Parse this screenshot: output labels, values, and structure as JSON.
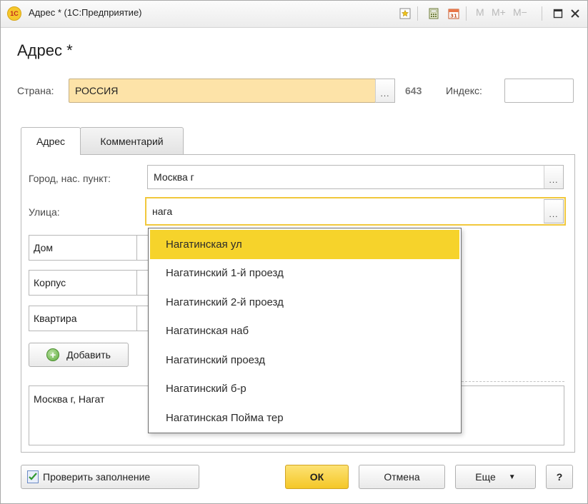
{
  "window": {
    "title": "Адрес * (1С:Предприятие)",
    "logo": "1С",
    "mem_buttons": [
      "M",
      "M+",
      "M−"
    ],
    "icons": [
      "favorite-icon",
      "calculator-icon",
      "calendar-icon",
      "maximize-icon",
      "close-icon"
    ]
  },
  "form": {
    "title": "Адрес *"
  },
  "country": {
    "label": "Страна:",
    "value": "РОССИЯ",
    "code": "643",
    "dots": "...",
    "index_label": "Индекс:",
    "index_value": ""
  },
  "tabs": [
    {
      "label": "Адрес",
      "active": true
    },
    {
      "label": "Комментарий",
      "active": false
    }
  ],
  "address": {
    "city_label": "Город, нас. пункт:",
    "city_value": "Москва г",
    "street_label": "Улица:",
    "street_value": "нага",
    "dots": "...",
    "house_label": "Дом",
    "building_label": "Корпус",
    "apartment_label": "Квартира",
    "add_button": "Добавить",
    "result_text": "Москва г, Нагат"
  },
  "dropdown": {
    "items": [
      "Нагатинская ул",
      "Нагатинский 1-й проезд",
      "Нагатинский 2-й проезд",
      "Нагатинская наб",
      "Нагатинский проезд",
      "Нагатинский б-р",
      "Нагатинская Пойма тер"
    ],
    "selected_index": 0
  },
  "footer": {
    "check_button": "Проверить заполнение",
    "ok_button": "ОК",
    "cancel_button": "Отмена",
    "more_button": "Еще",
    "help_button": "?"
  },
  "colors": {
    "accent_yellow": "#f6d32b",
    "country_field_bg": "#fde3a8",
    "focus_border": "#f1c83c"
  }
}
